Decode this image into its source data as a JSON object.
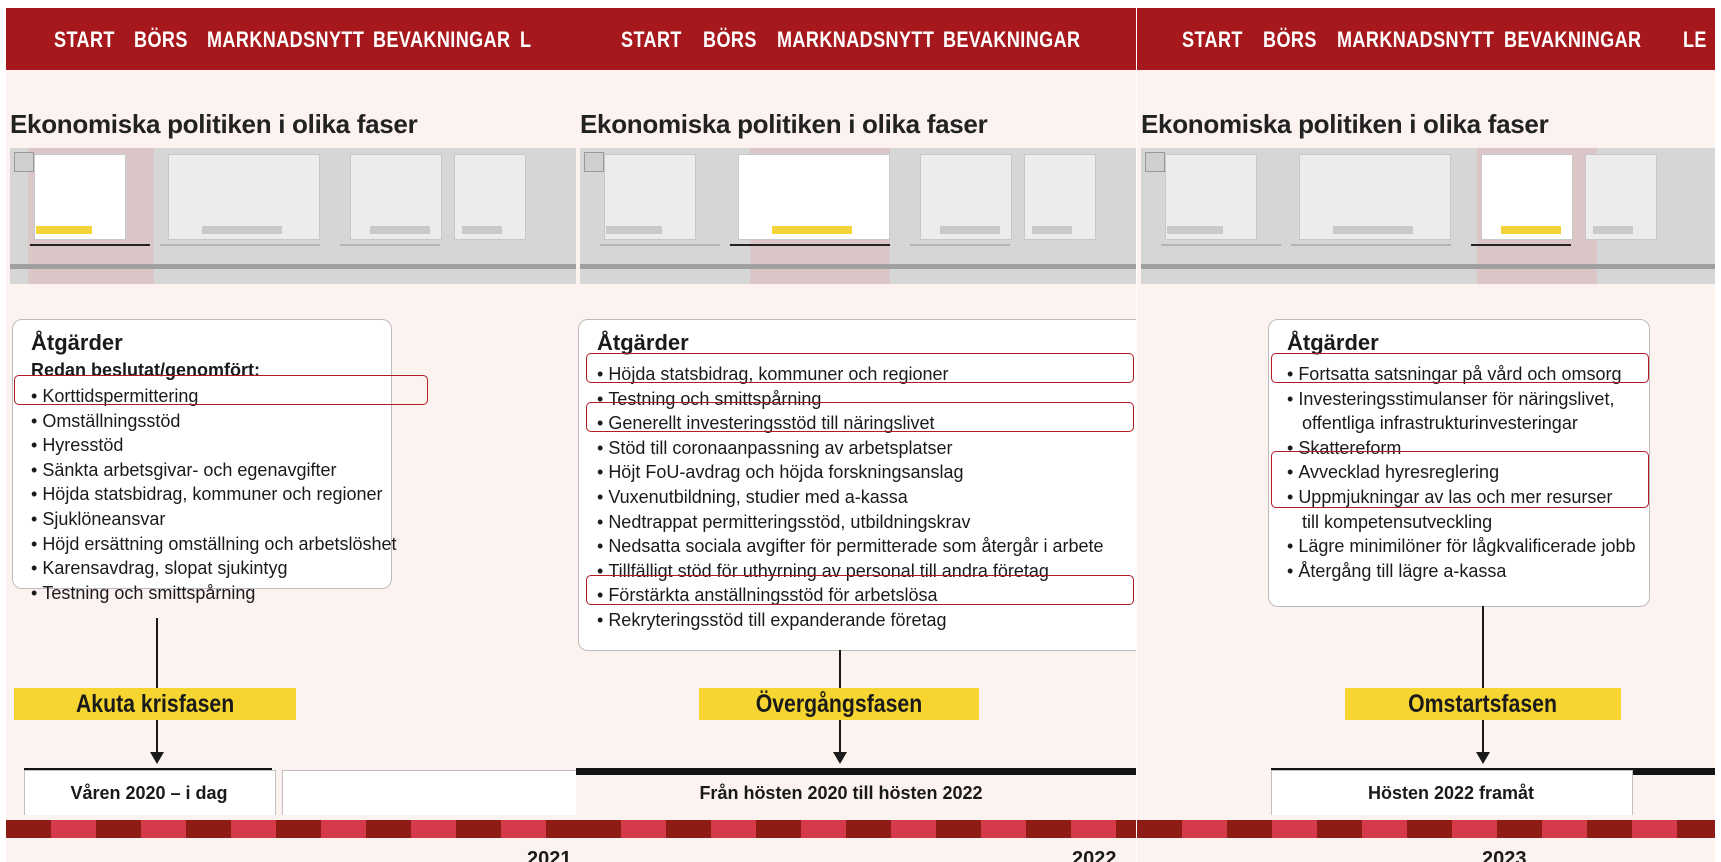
{
  "nav": [
    "START",
    "BÖRS",
    "MARKNADSNYTT",
    "BEVAKNINGAR"
  ],
  "nav_overflow": [
    "L",
    "LE"
  ],
  "page_title": "Ekonomiska politiken i olika faser",
  "heading": "Åtgärder",
  "colors": {
    "nav_bg": "#a7181d",
    "phase_bg": "#f7d530",
    "highlight": "#b01c22",
    "panel_bg": "#fcf3f0",
    "stripe_dark": "#8e1c14",
    "stripe_light": "#d53a4a"
  },
  "panels": [
    {
      "subheading": "Redan beslutat/genomfört:",
      "items": [
        "Korttidspermittering",
        "Omställningsstöd",
        "Hyresstöd",
        "Sänkta arbetsgivar- och egenavgifter",
        "Höjda statsbidrag, kommuner och regioner",
        "Sjuklöneansvar",
        "Höjd ersättning omställning och arbetslöshet",
        "Karensavdrag, slopat sjukintyg",
        "Testning och smittspårning"
      ],
      "phase": "Akuta krisfasen",
      "period": "Våren 2020 – i dag",
      "year": "2021"
    },
    {
      "items": [
        "Höjda statsbidrag, kommuner och regioner",
        "Testning och smittspårning",
        "Generellt investeringsstöd till näringslivet",
        "Stöd till coronaanpassning av arbetsplatser",
        "Höjt FoU-avdrag och höjda forskningsanslag",
        "Vuxenutbildning, studier med a-kassa",
        "Nedtrappat permitteringsstöd, utbildningskrav",
        "Nedsatta sociala avgifter för permitterade som återgår i arbete",
        "Tillfälligt stöd för uthyrning av personal till andra företag",
        "Förstärkta anställningsstöd för arbetslösa",
        "Rekryteringsstöd till expanderande företag"
      ],
      "phase": "Övergångsfasen",
      "period": "Från hösten 2020 till hösten 2022",
      "year": "2022"
    },
    {
      "items": [
        "Fortsatta satsningar på vård och omsorg",
        "Investeringsstimulanser för näringslivet,",
        "offentliga infrastrukturinvesteringar",
        "Skattereform",
        "Avvecklad hyresreglering",
        "Uppmjukningar av las och mer resurser",
        "till kompetensutveckling",
        "Lägre minimilöner för lågkvalificerade jobb",
        "Återgång till lägre a-kassa"
      ],
      "phase": "Omstartsfasen",
      "period": "Hösten 2022 framåt",
      "year": "2023"
    }
  ]
}
